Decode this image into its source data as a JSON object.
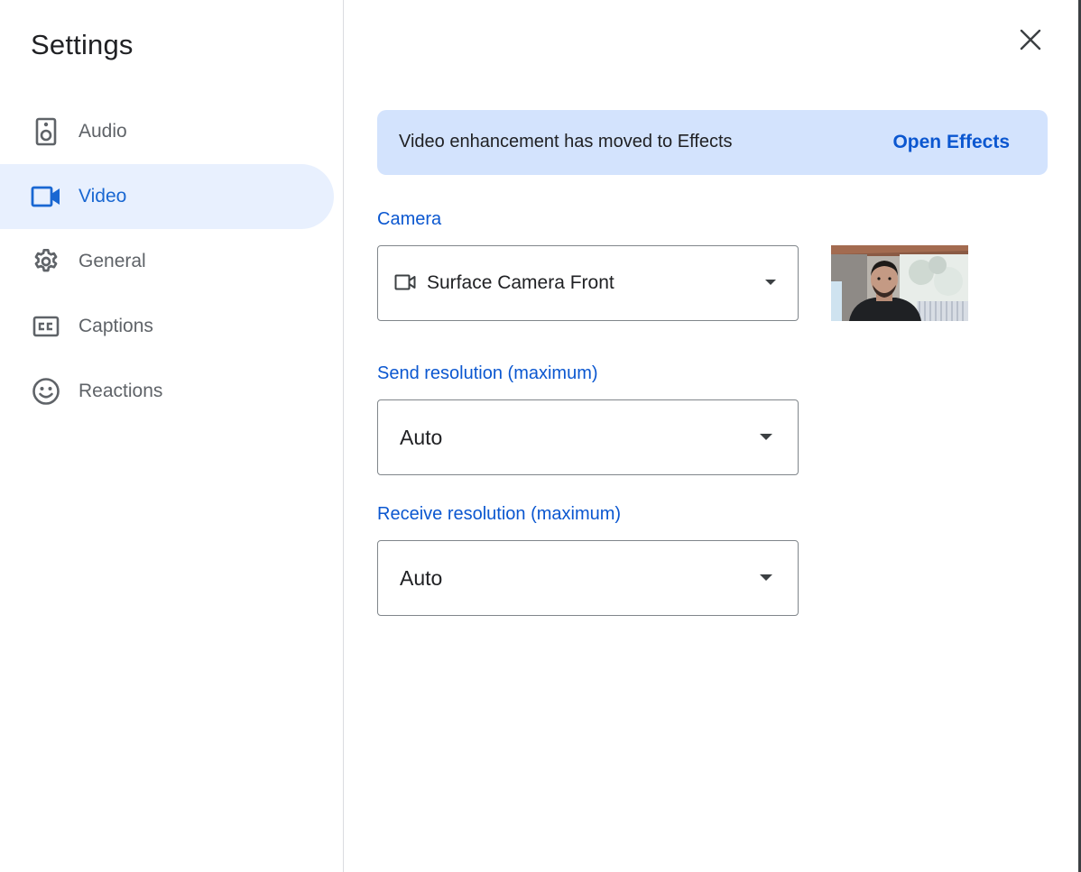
{
  "title": "Settings",
  "sidebar": {
    "items": [
      {
        "label": "Audio",
        "icon": "speaker-icon",
        "active": false
      },
      {
        "label": "Video",
        "icon": "videocam-icon",
        "active": true
      },
      {
        "label": "General",
        "icon": "gear-icon",
        "active": false
      },
      {
        "label": "Captions",
        "icon": "closed-captions-icon",
        "active": false
      },
      {
        "label": "Reactions",
        "icon": "smiley-face-icon",
        "active": false
      }
    ]
  },
  "close": {
    "icon": "close-icon"
  },
  "banner": {
    "text": "Video enhancement has moved to Effects",
    "link_label": "Open Effects"
  },
  "camera": {
    "label": "Camera",
    "value": "Surface Camera Front",
    "icon": "videocam-icon",
    "preview": "camera-preview-thumbnail"
  },
  "send_resolution": {
    "label": "Send resolution (maximum)",
    "value": "Auto"
  },
  "receive_resolution": {
    "label": "Receive resolution (maximum)",
    "value": "Auto"
  },
  "colors": {
    "accent": "#0b57d0",
    "active_bg": "#e8f0fe",
    "banner_bg": "#d3e3fd",
    "text": "#202124",
    "secondary_text": "#5f6368"
  }
}
